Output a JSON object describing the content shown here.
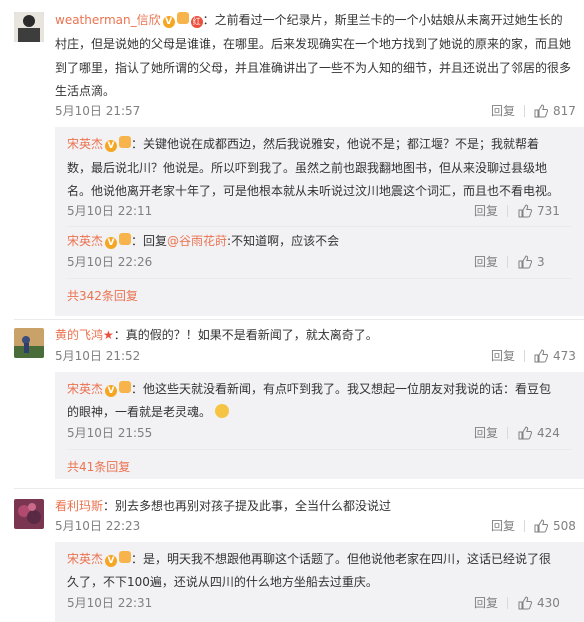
{
  "comments": [
    {
      "user": "weatherman_信欣",
      "lines": [
        "：之前看过一个纪录片，斯里兰卡的一个小姑娘从未离开过她生长的",
        "村庄，但是说她的父母是谁谁，在哪里。后来发现确实在一个地方找到了她说的原来的家，而且她",
        "到了哪里，指认了她所谓的父母，并且准确讲出了一些不为人知的细节，并且还说出了邻居的很多",
        "生活点滴。"
      ],
      "time": "5月10日 21:57",
      "reply": "回复",
      "likes": "817",
      "replies": [
        {
          "user": "宋英杰",
          "lines": [
            "：关键他说在成都西边，然后我说雅安，他说不是；都江堰？不是；我就帮着",
            "数，最后说北川？他说是。所以吓到我了。虽然之前也跟我翻地图书，但从来没聊过县级地",
            "名。他说他离开老家十年了，可是他根本就从未听说过汶川地震这个词汇，而且也不看电视。"
          ],
          "time": "5月10日 22:11",
          "reply": "回复",
          "likes": "731"
        },
        {
          "user": "宋英杰",
          "prefix": "：回复",
          "mention": "@谷雨花莳",
          "suffix": ":不知道啊，应该不会",
          "time": "5月10日 22:26",
          "reply": "回复",
          "likes": "3"
        }
      ],
      "more": "共342条回复"
    },
    {
      "user": "黄的飞鸿",
      "text": "：真的假的？！如果不是看新闻了，就太离奇了。",
      "time": "5月10日 21:52",
      "reply": "回复",
      "likes": "473",
      "replies": [
        {
          "user": "宋英杰",
          "lines": [
            "：他这些天就没看新闻，有点吓到我了。我又想起一位朋友对我说的话：看豆包",
            "的眼神，一看就是老灵魂。"
          ],
          "time": "5月10日 21:55",
          "reply": "回复",
          "likes": "424"
        }
      ],
      "more": "共41条回复"
    },
    {
      "user": "看利玛斯",
      "text": "：别去多想也再别对孩子提及此事，全当什么都没说过",
      "time": "5月10日 22:23",
      "reply": "回复",
      "likes": "508",
      "replies": [
        {
          "user": "宋英杰",
          "lines": [
            "：是，明天我不想跟他再聊这个话题了。但他说他老家在四川，这话已经说了很",
            "久了，不下100遍，还说从四川的什么地方坐船去过重庆。"
          ],
          "time": "5月10日 22:31",
          "reply": "回复",
          "likes": "430"
        }
      ]
    }
  ],
  "colors": {
    "name": "#eb7350",
    "reply_box": "#f2f2f5",
    "meta": "#808080"
  },
  "icons": {
    "like": "thumbs-up-icon",
    "verified": "verified-v-icon",
    "member": "member-badge-icon",
    "red": "red-badge-icon",
    "star": "star-icon",
    "emoji": "face-emoji-icon"
  }
}
